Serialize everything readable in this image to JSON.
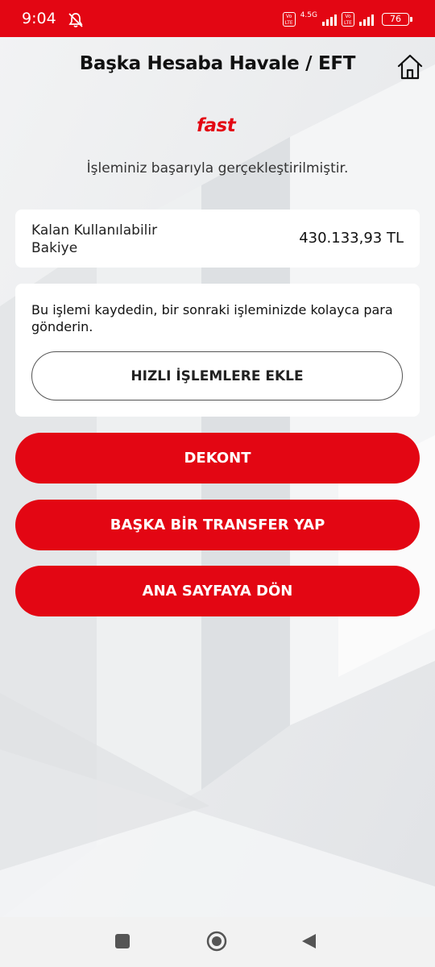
{
  "status_bar": {
    "time": "9:04",
    "sim1_label": "Vo LTE",
    "network_type": "4.5G",
    "sim2_label": "Vo LTE",
    "battery_level": "76",
    "icons": [
      "bell-off-icon",
      "signal-bars-icon",
      "battery-icon"
    ]
  },
  "header": {
    "title": "Başka Hesaba Havale / EFT",
    "home_icon": "home-icon"
  },
  "confirmation": {
    "logo_text": "fast",
    "message": "İşleminiz başarıyla gerçekleştirilmiştir."
  },
  "balance": {
    "label": "Kalan Kullanılabilir Bakiye",
    "value": "430.133,93 TL"
  },
  "save_transaction": {
    "text": "Bu işlemi kaydedin, bir sonraki işleminizde kolayca para gönderin.",
    "button_label": "HIZLI İŞLEMLERE EKLE"
  },
  "actions": {
    "receipt_label": "DEKONT",
    "another_transfer_label": "BAŞKA BİR TRANSFER YAP",
    "home_label": "ANA SAYFAYA DÖN"
  },
  "nav_bar": {
    "icons": [
      "recents-icon",
      "home-circle-icon",
      "back-icon"
    ]
  },
  "colors": {
    "brand_red": "#e30613",
    "background": "#e9ebed",
    "card": "#ffffff"
  }
}
